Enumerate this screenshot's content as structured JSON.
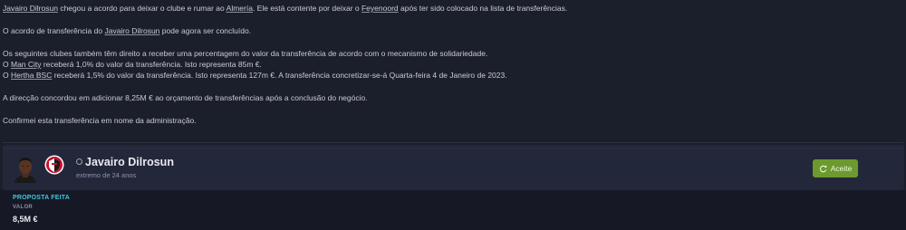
{
  "message": {
    "p1": {
      "player": "Javairo Dilrosun",
      "t1": " chegou a acordo para deixar o clube e rumar ao ",
      "club_dest": "Almería",
      "t2": ". Ele está contente por deixar o ",
      "club_from": "Feyenoord",
      "t3": " após ter sido colocado na lista de transferências."
    },
    "p2": {
      "t1": "O acordo de transferência do ",
      "player": "Javairo Dilrosun",
      "t2": " pode agora ser concluído."
    },
    "p3": {
      "intro": "Os seguintes clubes também têm direito a receber uma percentagem do valor da transferência de acordo com o mecanismo de solidariedade.",
      "line1_pre": "O ",
      "line1_club": "Man City",
      "line1_post": " receberá 1,0% do valor da transferência. Isto representa 85m €.",
      "line2_pre": "O ",
      "line2_club": "Hertha BSC",
      "line2_post": " receberá 1,5% do valor da transferência. Isto representa 127m €. A transferência concretizar-se-á Quarta-feira 4 de Janeiro de 2023."
    },
    "p4": "A direcção concordou em adicionar 8,25M € ao orçamento de transferências após a conclusão do negócio.",
    "p5": "Confirmei esta transferência em nome da administração."
  },
  "card": {
    "player_name": "Javairo Dilrosun",
    "player_sub": "extremo de 24 anos",
    "accept_label": "Aceite",
    "status": "PROPOSTA FEITA",
    "value_label": "VALOR",
    "value_amount": "8,5M €"
  },
  "colors": {
    "background": "#1b1e2b",
    "card": "#23273a",
    "accept_button": "#6d9a2e",
    "status_accent": "#3fc7e0"
  },
  "icons": [
    "player-photo",
    "feyenoord-badge-icon",
    "star-icon",
    "refresh-icon"
  ]
}
